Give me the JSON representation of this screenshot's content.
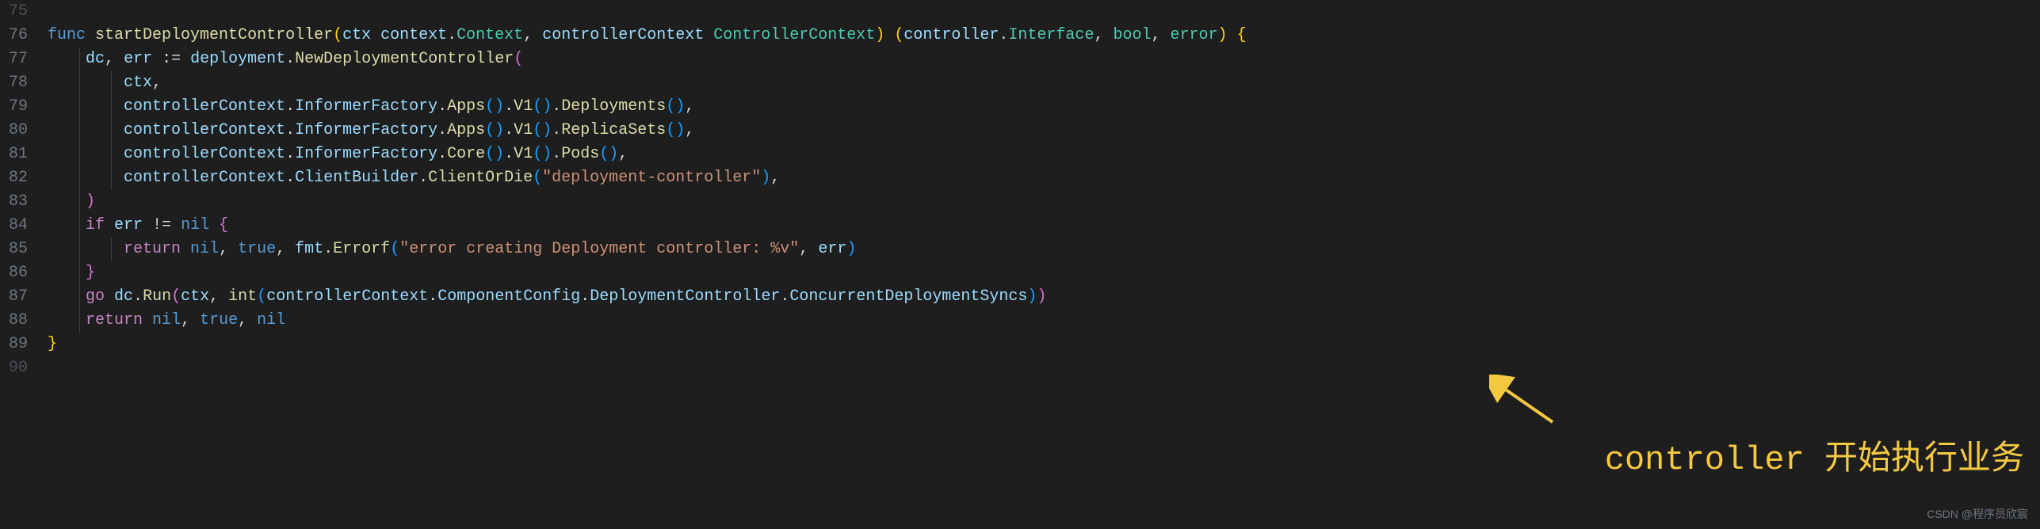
{
  "lineNumbers": [
    "75",
    "76",
    "77",
    "78",
    "79",
    "80",
    "81",
    "82",
    "83",
    "84",
    "85",
    "86",
    "87",
    "88",
    "89",
    "90"
  ],
  "code": {
    "l76": {
      "func": "func",
      "name": "startDeploymentController",
      "p1": "ctx",
      "t1": "context",
      "t1b": "Context",
      "p2": "controllerContext",
      "t2": "ControllerContext",
      "rt1": "controller",
      "rt1b": "Interface",
      "rt2": "bool",
      "rt3": "error"
    },
    "l77": {
      "v1": "dc",
      "v2": "err",
      "assign": ":=",
      "pkg": "deployment",
      "method": "NewDeploymentController"
    },
    "l78": {
      "var": "ctx"
    },
    "l79": {
      "var": "controllerContext",
      "m1": "InformerFactory",
      "m2": "Apps",
      "m3": "V1",
      "m4": "Deployments"
    },
    "l80": {
      "var": "controllerContext",
      "m1": "InformerFactory",
      "m2": "Apps",
      "m3": "V1",
      "m4": "ReplicaSets"
    },
    "l81": {
      "var": "controllerContext",
      "m1": "InformerFactory",
      "m2": "Core",
      "m3": "V1",
      "m4": "Pods"
    },
    "l82": {
      "var": "controllerContext",
      "m1": "ClientBuilder",
      "m2": "ClientOrDie",
      "str": "\"deployment-controller\""
    },
    "l84": {
      "kw": "if",
      "var": "err",
      "op": "!=",
      "nil": "nil"
    },
    "l85": {
      "kw": "return",
      "nil": "nil",
      "bool": "true",
      "pkg": "fmt",
      "method": "Errorf",
      "str": "\"error creating Deployment controller: %v\"",
      "var": "err"
    },
    "l87": {
      "kw": "go",
      "var": "dc",
      "m1": "Run",
      "p1": "ctx",
      "fn": "int",
      "p2": "controllerContext",
      "p3": "ComponentConfig",
      "p4": "DeploymentController",
      "p5": "ConcurrentDeploymentSyncs"
    },
    "l88": {
      "kw": "return",
      "nil": "nil",
      "bool": "true",
      "nil2": "nil"
    }
  },
  "annotation": "controller 开始执行业务",
  "watermark": "CSDN @程序员欣宸"
}
